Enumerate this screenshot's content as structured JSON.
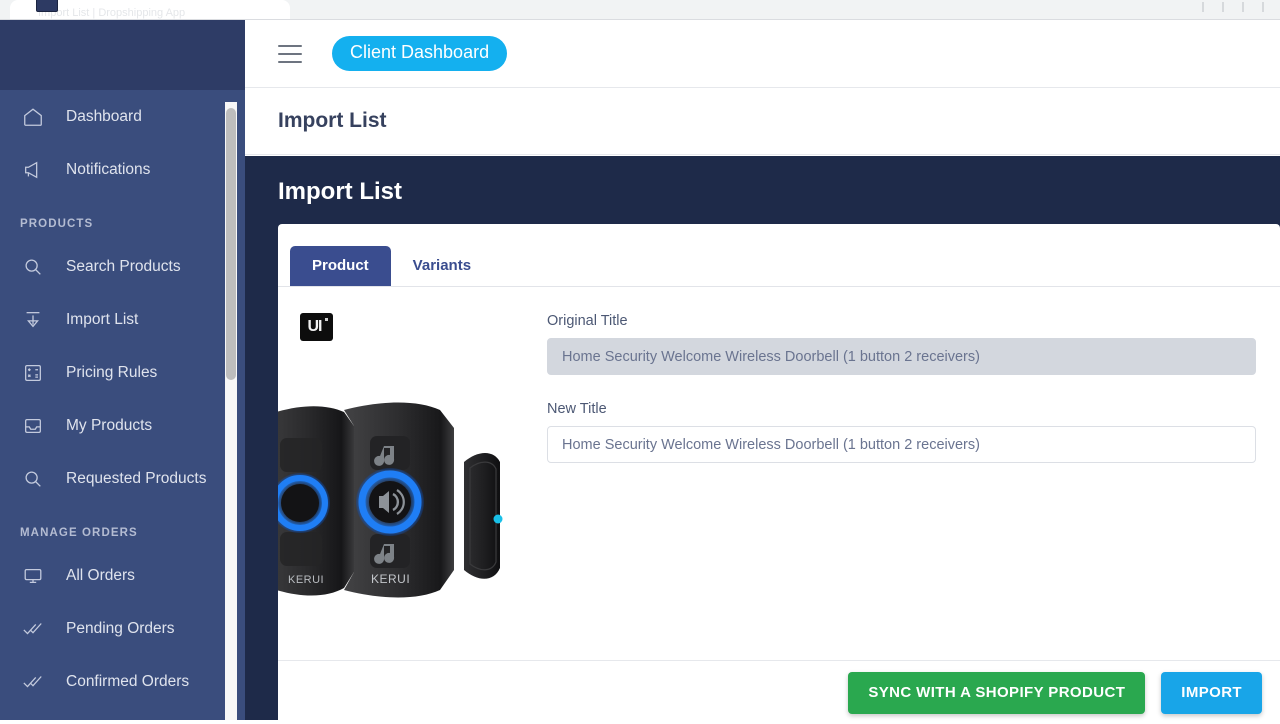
{
  "browser": {
    "tab_title": "Import List | Dropshipping App",
    "favicon_name": "app-favicon"
  },
  "sidebar": {
    "brand_area": "",
    "groups": [
      {
        "section_label": "",
        "items": [
          {
            "label": "Dashboard",
            "icon": "home-icon"
          },
          {
            "label": "Notifications",
            "icon": "megaphone-icon"
          }
        ]
      },
      {
        "section_label": "PRODUCTS",
        "items": [
          {
            "label": "Search Products",
            "icon": "magnifier-icon"
          },
          {
            "label": "Import List",
            "icon": "download-arrow-icon"
          },
          {
            "label": "Pricing Rules",
            "icon": "calculator-icon"
          },
          {
            "label": "My Products",
            "icon": "inbox-tray-icon"
          },
          {
            "label": "Requested Products",
            "icon": "magnifier-icon"
          }
        ]
      },
      {
        "section_label": "MANAGE ORDERS",
        "items": [
          {
            "label": "All Orders",
            "icon": "monitor-icon"
          },
          {
            "label": "Pending Orders",
            "icon": "double-check-icon"
          },
          {
            "label": "Confirmed Orders",
            "icon": "double-check-icon"
          }
        ]
      }
    ]
  },
  "topbar": {
    "menu_icon": "hamburger-icon",
    "dashboard_chip": "Client Dashboard"
  },
  "breadcrumb": {
    "title": "Import List"
  },
  "panel": {
    "title": "Import List",
    "tabs": [
      {
        "label": "Product",
        "active": true
      },
      {
        "label": "Variants",
        "active": false
      }
    ]
  },
  "product": {
    "brand_badge_text": "UI",
    "image_alt": "KERUI wireless doorbell receivers and push button",
    "fields": [
      {
        "label": "Original Title",
        "value": "Home Security Welcome Wireless Doorbell (1 button 2 receivers)",
        "readonly": true
      },
      {
        "label": "New Title",
        "value": "Home Security Welcome Wireless Doorbell (1 button 2 receivers)",
        "readonly": false
      }
    ]
  },
  "footer": {
    "sync_label": "SYNC WITH A SHOPIFY PRODUCT",
    "import_label": "IMPORT"
  },
  "colors": {
    "sidebar": "#3a4d7d",
    "sidebar_header": "#2e3c66",
    "content_bg": "#1e2a49",
    "chip_blue": "#14b0ef",
    "tab_active": "#3a4d8f",
    "sync_green": "#2aa84f",
    "import_blue": "#18a5e8"
  }
}
